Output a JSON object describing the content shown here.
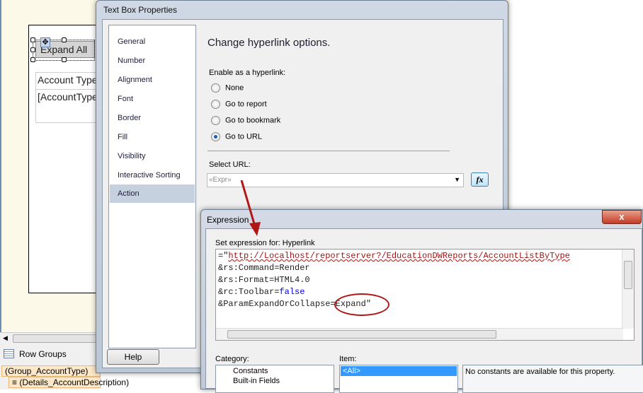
{
  "designer": {
    "expand_button": "Expand All",
    "table_header": "Account Type",
    "table_cell": "[AccountType]",
    "row_groups_label": "Row Groups",
    "groups": [
      "(Group_AccountType)",
      "(Details_AccountDescription)"
    ]
  },
  "tbp": {
    "title": "Text Box Properties",
    "nav": [
      "General",
      "Number",
      "Alignment",
      "Font",
      "Border",
      "Fill",
      "Visibility",
      "Interactive Sorting",
      "Action"
    ],
    "active_nav": "Action",
    "heading": "Change hyperlink options.",
    "enable_label": "Enable as a hyperlink:",
    "options": [
      "None",
      "Go to report",
      "Go to bookmark",
      "Go to URL"
    ],
    "selected_option": "Go to URL",
    "select_url_label": "Select URL:",
    "select_url_value": "«Expr»",
    "fx_label": "fx",
    "help": "Help"
  },
  "expr": {
    "title": "Expression",
    "close": "x",
    "set_for": "Set expression for: Hyperlink",
    "line1_prefix": "=\"",
    "line1_url": "http://Localhost/reportserver?/EducationDWReports/AccountListByType",
    "line2": "&rs:Command=Render",
    "line3": "&rs:Format=HTML4.0",
    "line4_prefix": "&rc:Toolbar=",
    "line4_kw": "false",
    "line5": "&ParamExpandOrCollapse=Expand\"",
    "category_label": "Category:",
    "categories": [
      "Constants",
      "Built-in Fields"
    ],
    "item_label": "Item:",
    "items": [
      "<All>"
    ],
    "description": "No constants are available for this property."
  },
  "colors": {
    "annotation": "#b01818",
    "selected": "#3399ff"
  }
}
